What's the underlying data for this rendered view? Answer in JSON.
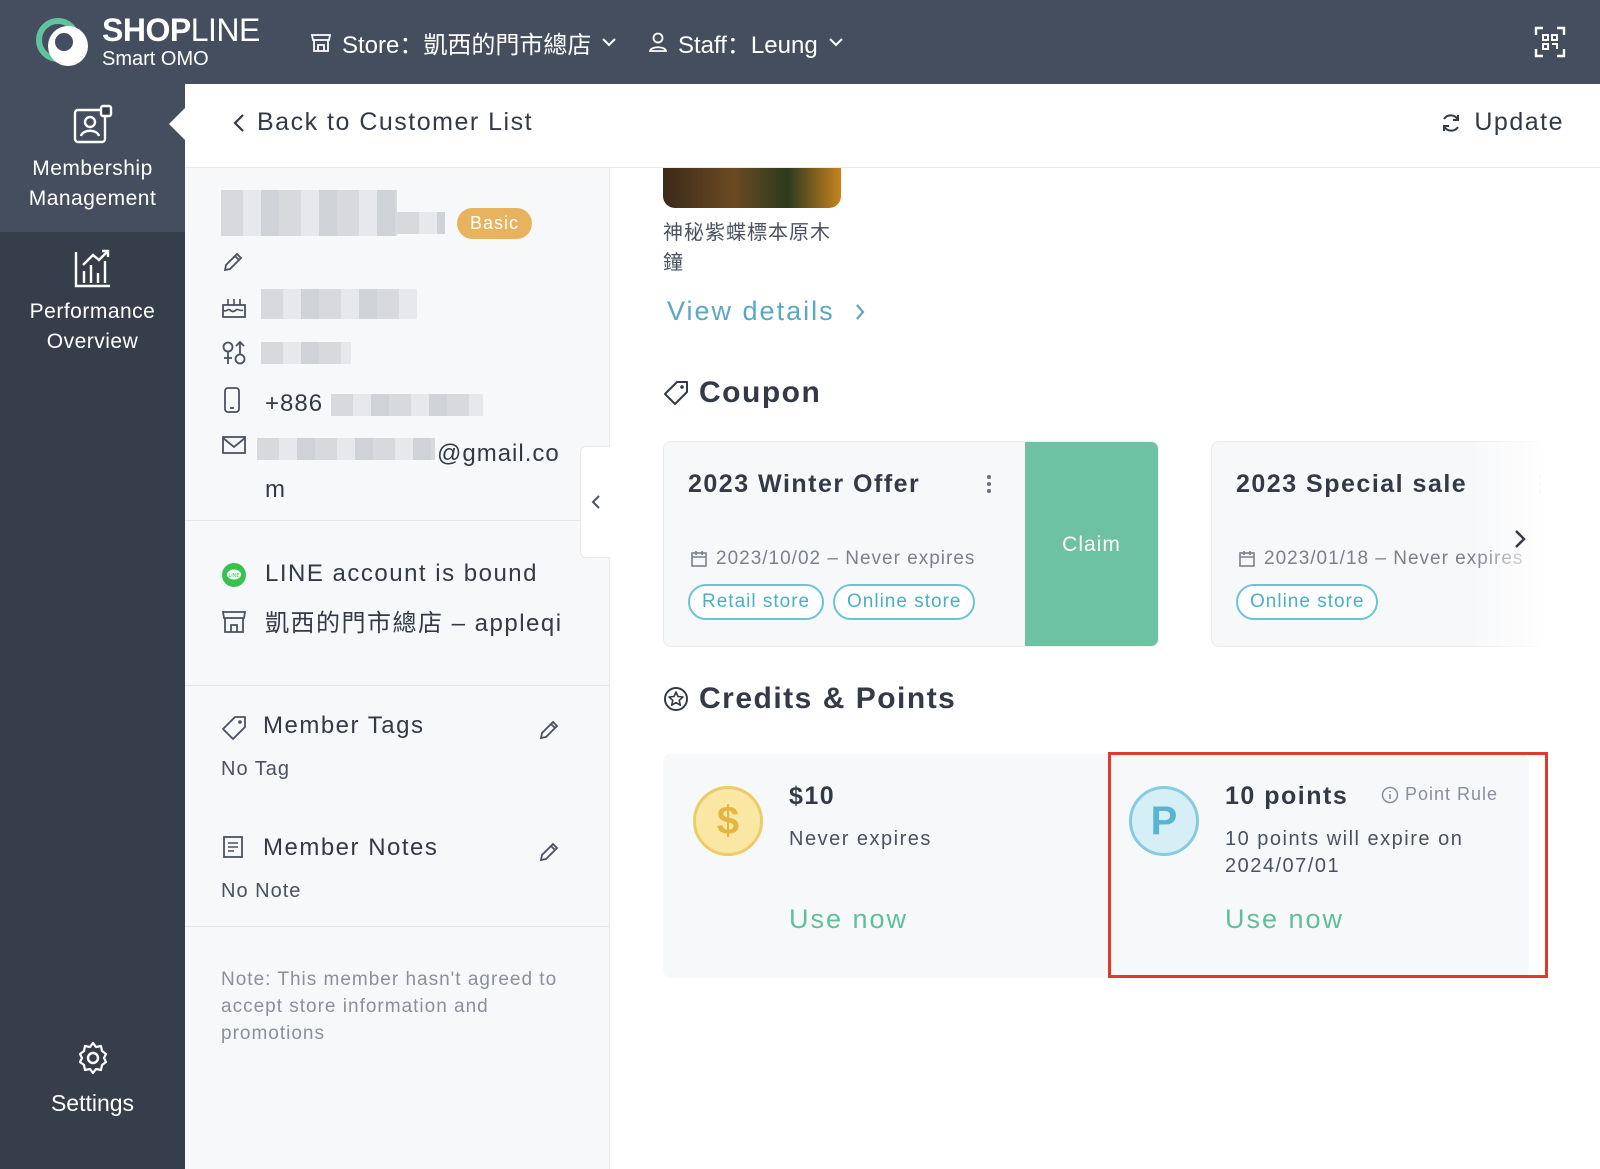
{
  "topbar": {
    "brand_bold": "SHOP",
    "brand_light": "LINE",
    "brand_sub": "Smart OMO",
    "store_label": "Store：凱西的門市總店",
    "staff_label": "Staff：Leung"
  },
  "sidebar": {
    "items": [
      {
        "label": "Membership Management",
        "icon": "member-card-icon"
      },
      {
        "label": "Performance Overview",
        "icon": "chart-icon"
      }
    ],
    "settings_label": "Settings"
  },
  "header": {
    "back_label": "Back to Customer List",
    "update_label": "Update"
  },
  "customer": {
    "tier_badge": "Basic",
    "phone_prefix": "+886",
    "email_suffix": "@gmail.co",
    "email_wrap": "m",
    "line_status": "LINE account is bound",
    "store_name": "凱西的門市總店 – appleqi",
    "tags_title": "Member Tags",
    "tags_value": "No Tag",
    "notes_title": "Member Notes",
    "notes_value": "No Note",
    "consent_note": "Note: This member hasn't agreed to accept store information and promotions"
  },
  "main": {
    "product_name": "神秘紫蝶標本原木鐘",
    "view_details": "View details",
    "coupon_title": "Coupon",
    "coupons": [
      {
        "title": "2023 Winter Offer",
        "date": "2023/10/02 – Never expires",
        "chips": [
          "Retail store",
          "Online store"
        ],
        "action": "Claim"
      },
      {
        "title": "2023 Special sale",
        "date": "2023/01/18 – Never expires",
        "chips": [
          "Online store"
        ]
      }
    ],
    "credits_title": "Credits & Points",
    "credit": {
      "amount": "$10",
      "expiry": "Never expires",
      "action": "Use now",
      "symbol": "$"
    },
    "points": {
      "amount": "10 points",
      "rule": "Point Rule",
      "expiry": "10 points will expire on 2024/07/01",
      "action": "Use now",
      "symbol": "P"
    }
  },
  "colors": {
    "topbar": "#454e5e",
    "sidebar": "#363e4b",
    "accent_green": "#6cc2a3",
    "accent_blue": "#5aa7c4",
    "highlight": "#e03a2c"
  }
}
